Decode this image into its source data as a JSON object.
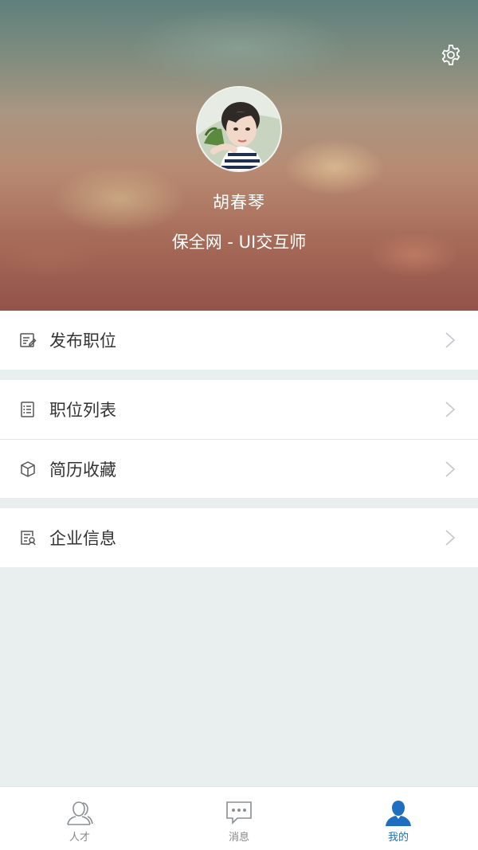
{
  "profile": {
    "name": "胡春琴",
    "subtitle": "保全网 - UI交互师"
  },
  "menu": {
    "publish_job": "发布职位",
    "job_list": "职位列表",
    "resume_favorites": "简历收藏",
    "company_info": "企业信息"
  },
  "tabbar": {
    "talent": "人才",
    "messages": "消息",
    "mine": "我的",
    "active_tab": "我的",
    "active_color": "#1e6fbf"
  }
}
